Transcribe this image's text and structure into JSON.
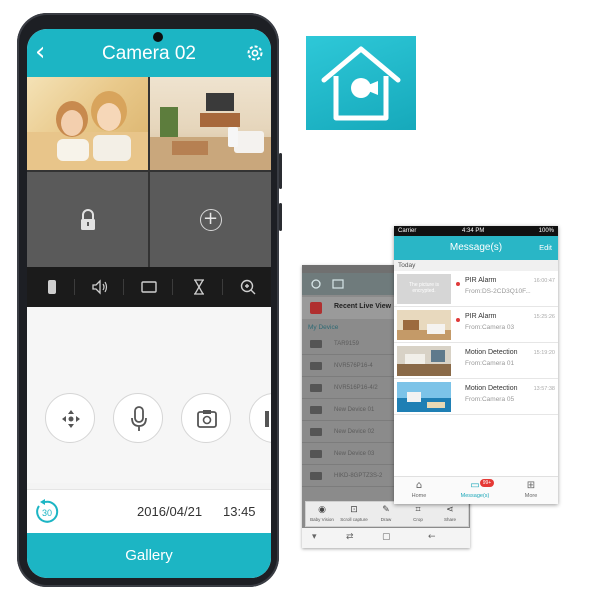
{
  "colors": {
    "accent": "#1cb5c4",
    "phone_body": "#1d1f24",
    "alert_red": "#e03a3a"
  },
  "phone": {
    "header": {
      "back_icon": "chevron-left-icon",
      "title": "Camera 02",
      "settings_icon": "gear-icon"
    },
    "grid": [
      {
        "tile": "camera-feed-kids"
      },
      {
        "tile": "camera-feed-living-room"
      },
      {
        "tile": "locked",
        "icon": "lock-icon"
      },
      {
        "tile": "add",
        "icon": "plus-circle-icon",
        "glyph": "+"
      }
    ],
    "toolbar": [
      "record-icon",
      "volume-icon",
      "fullscreen-icon",
      "hourglass-icon",
      "zoom-in-icon"
    ],
    "controls": [
      "ptz-icon",
      "microphone-icon",
      "snapshot-icon",
      "more-icon"
    ],
    "datebar": {
      "replay_label": "30",
      "date": "2016/04/21",
      "time": "13:45"
    },
    "gallery_label": "Gallery"
  },
  "app_icon": {
    "icon": "home-camera-icon"
  },
  "android": {
    "recent_label": "Recent Live View",
    "section_label": "My Device",
    "devices": [
      "TAR9159",
      "NVR576P16-4",
      "NVR516P16-4/2",
      "New Device 01",
      "New Device 02",
      "New Device 03",
      "HIKD-8GPTZ3S-2"
    ],
    "actions": [
      {
        "icon": "eye-icon",
        "glyph": "◉",
        "label": "Baby Vision"
      },
      {
        "icon": "capture-icon",
        "glyph": "⊡",
        "label": "Scroll capture"
      },
      {
        "icon": "pen-icon",
        "glyph": "✎",
        "label": "Draw"
      },
      {
        "icon": "crop-icon",
        "glyph": "⌗",
        "label": "Crop"
      },
      {
        "icon": "share-icon",
        "glyph": "⋖",
        "label": "Share"
      }
    ],
    "nav": [
      {
        "icon": "menu-icon",
        "glyph": "▾"
      },
      {
        "icon": "recent-icon",
        "glyph": "⇄"
      },
      {
        "icon": "home-icon",
        "glyph": "▢"
      },
      {
        "icon": "back-icon",
        "glyph": "←"
      }
    ]
  },
  "ios": {
    "status": {
      "carrier": "Carrier",
      "time": "4:34 PM",
      "battery": "100%"
    },
    "title": "Message(s)",
    "edit": "Edit",
    "section": "Today",
    "messages": [
      {
        "thumb_text": "The picture is encrypted.",
        "title": "PIR Alarm",
        "from": "From:DS-2CD3Q10F...",
        "time": "16:00:47",
        "unread": true
      },
      {
        "thumb_text": "",
        "title": "PIR Alarm",
        "from": "From:Camera 03",
        "time": "15:25:26",
        "unread": true
      },
      {
        "thumb_text": "",
        "title": "Motion Detection",
        "from": "From:Camera 01",
        "time": "15:19:20",
        "unread": false
      },
      {
        "thumb_text": "",
        "title": "Motion Detection",
        "from": "From:Camera 05",
        "time": "13:57:38",
        "unread": false
      }
    ],
    "tabs": [
      {
        "icon": "home-icon",
        "glyph": "⌂",
        "label": "Home"
      },
      {
        "icon": "message-icon",
        "glyph": "▭",
        "label": "Message(s)",
        "badge": "99+"
      },
      {
        "icon": "more-grid-icon",
        "glyph": "⊞",
        "label": "More"
      }
    ]
  }
}
